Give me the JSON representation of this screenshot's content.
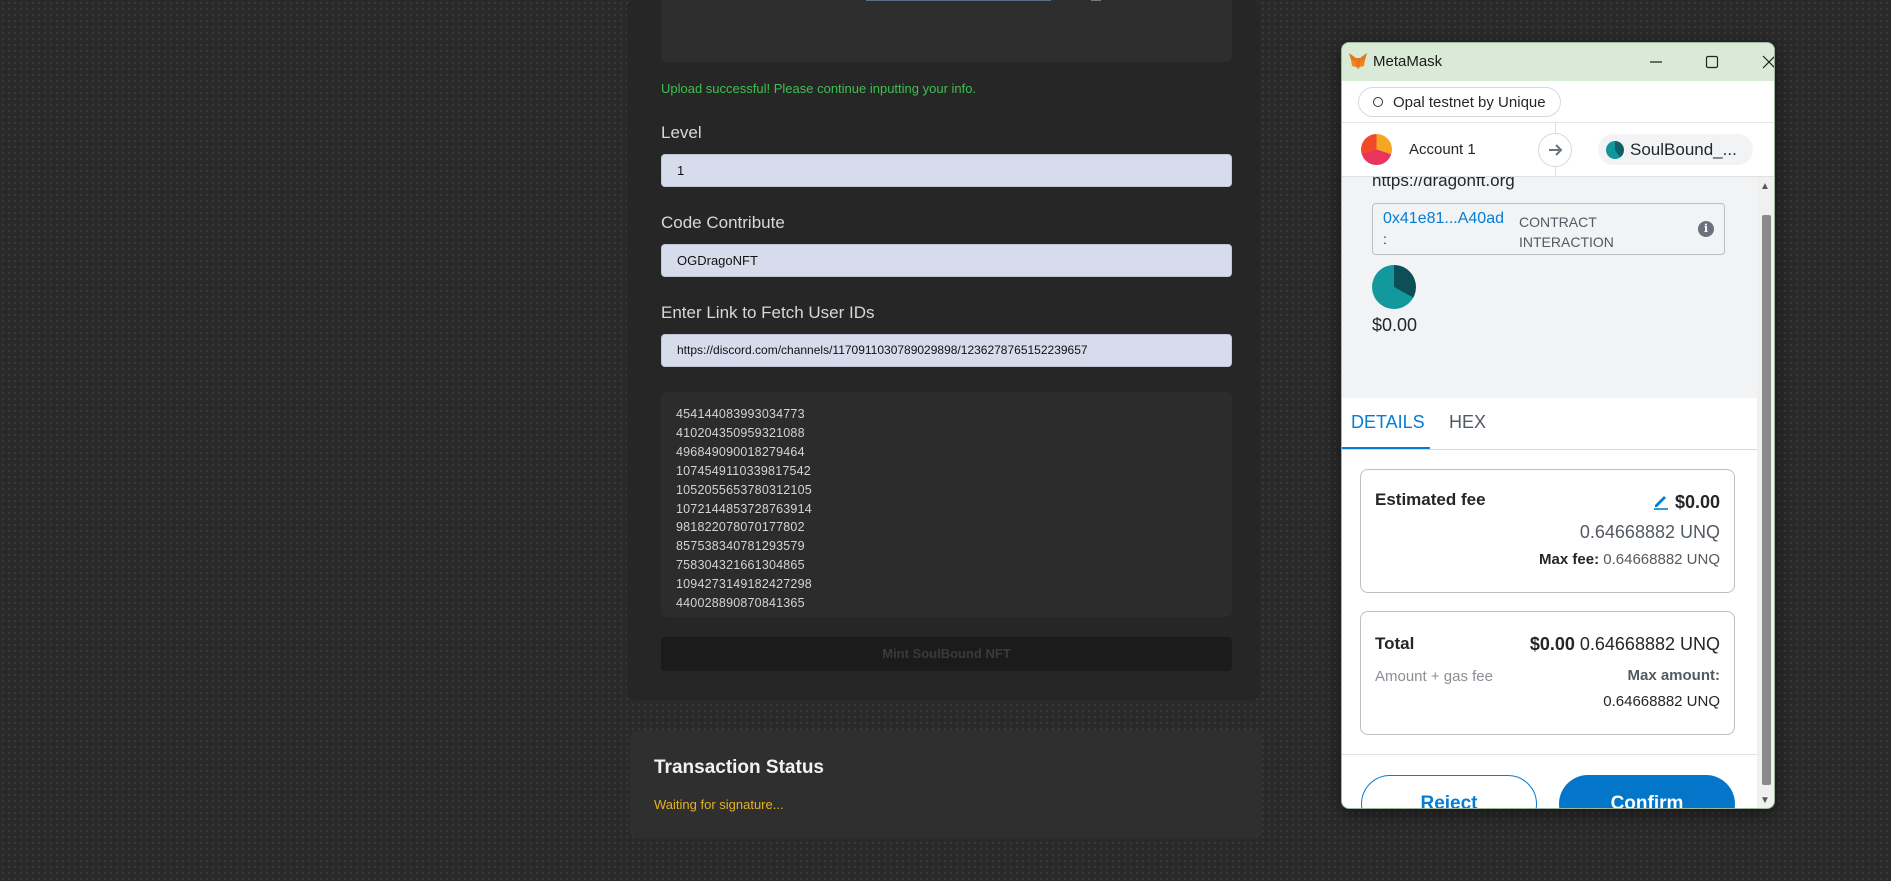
{
  "dapp": {
    "upload_message": "Upload successful! Please continue inputting your info.",
    "level_label": "Level",
    "level_value": "1",
    "code_label": "Code Contribute",
    "code_value": "OGDragoNFT",
    "link_label": "Enter Link to Fetch User IDs",
    "link_value": "https://discord.com/channels/1170911030789029898/1236278765152239657",
    "user_ids": [
      "454144083993034773",
      "410204350959321088",
      "496849090018279464",
      "1074549110339817542",
      "1052055653780312105",
      "1072144853728763914",
      "981822078070177802",
      "857538340781293579",
      "758304321661304865",
      "1094273149182427298",
      "440028890870841365"
    ],
    "mint_button": "Mint SoulBound NFT",
    "status_title": "Transaction Status",
    "status_text": "Waiting for signature..."
  },
  "metamask": {
    "window_title": "MetaMask",
    "network": "Opal testnet by Unique",
    "account_name": "Account 1",
    "contract_name": "SoulBound_...",
    "origin": "https://dragonft.org",
    "contract_address": "0x41e81...A40ad",
    "contract_colon": ":",
    "interaction_type": "CONTRACT INTERACTION",
    "value_usd": "$0.00",
    "tabs": [
      "DETAILS",
      "HEX"
    ],
    "estimated_fee": {
      "label": "Estimated fee",
      "usd": "$0.00",
      "amount": "0.64668882 UNQ",
      "max_fee_label": "Max fee:",
      "max_fee_value": "0.64668882 UNQ"
    },
    "total": {
      "label": "Total",
      "usd": "$0.00",
      "amount": "0.64668882 UNQ",
      "sub_label": "Amount + gas fee",
      "max_amount_label": "Max amount:",
      "max_amount_value": "0.64668882 UNQ"
    },
    "reject_button": "Reject",
    "confirm_button": "Confirm"
  },
  "colors": {
    "accent_blue": "#037dd6",
    "success_green": "#3fbf4f",
    "status_yellow": "#e3b224",
    "titlebar_green": "#d9ebd6"
  }
}
